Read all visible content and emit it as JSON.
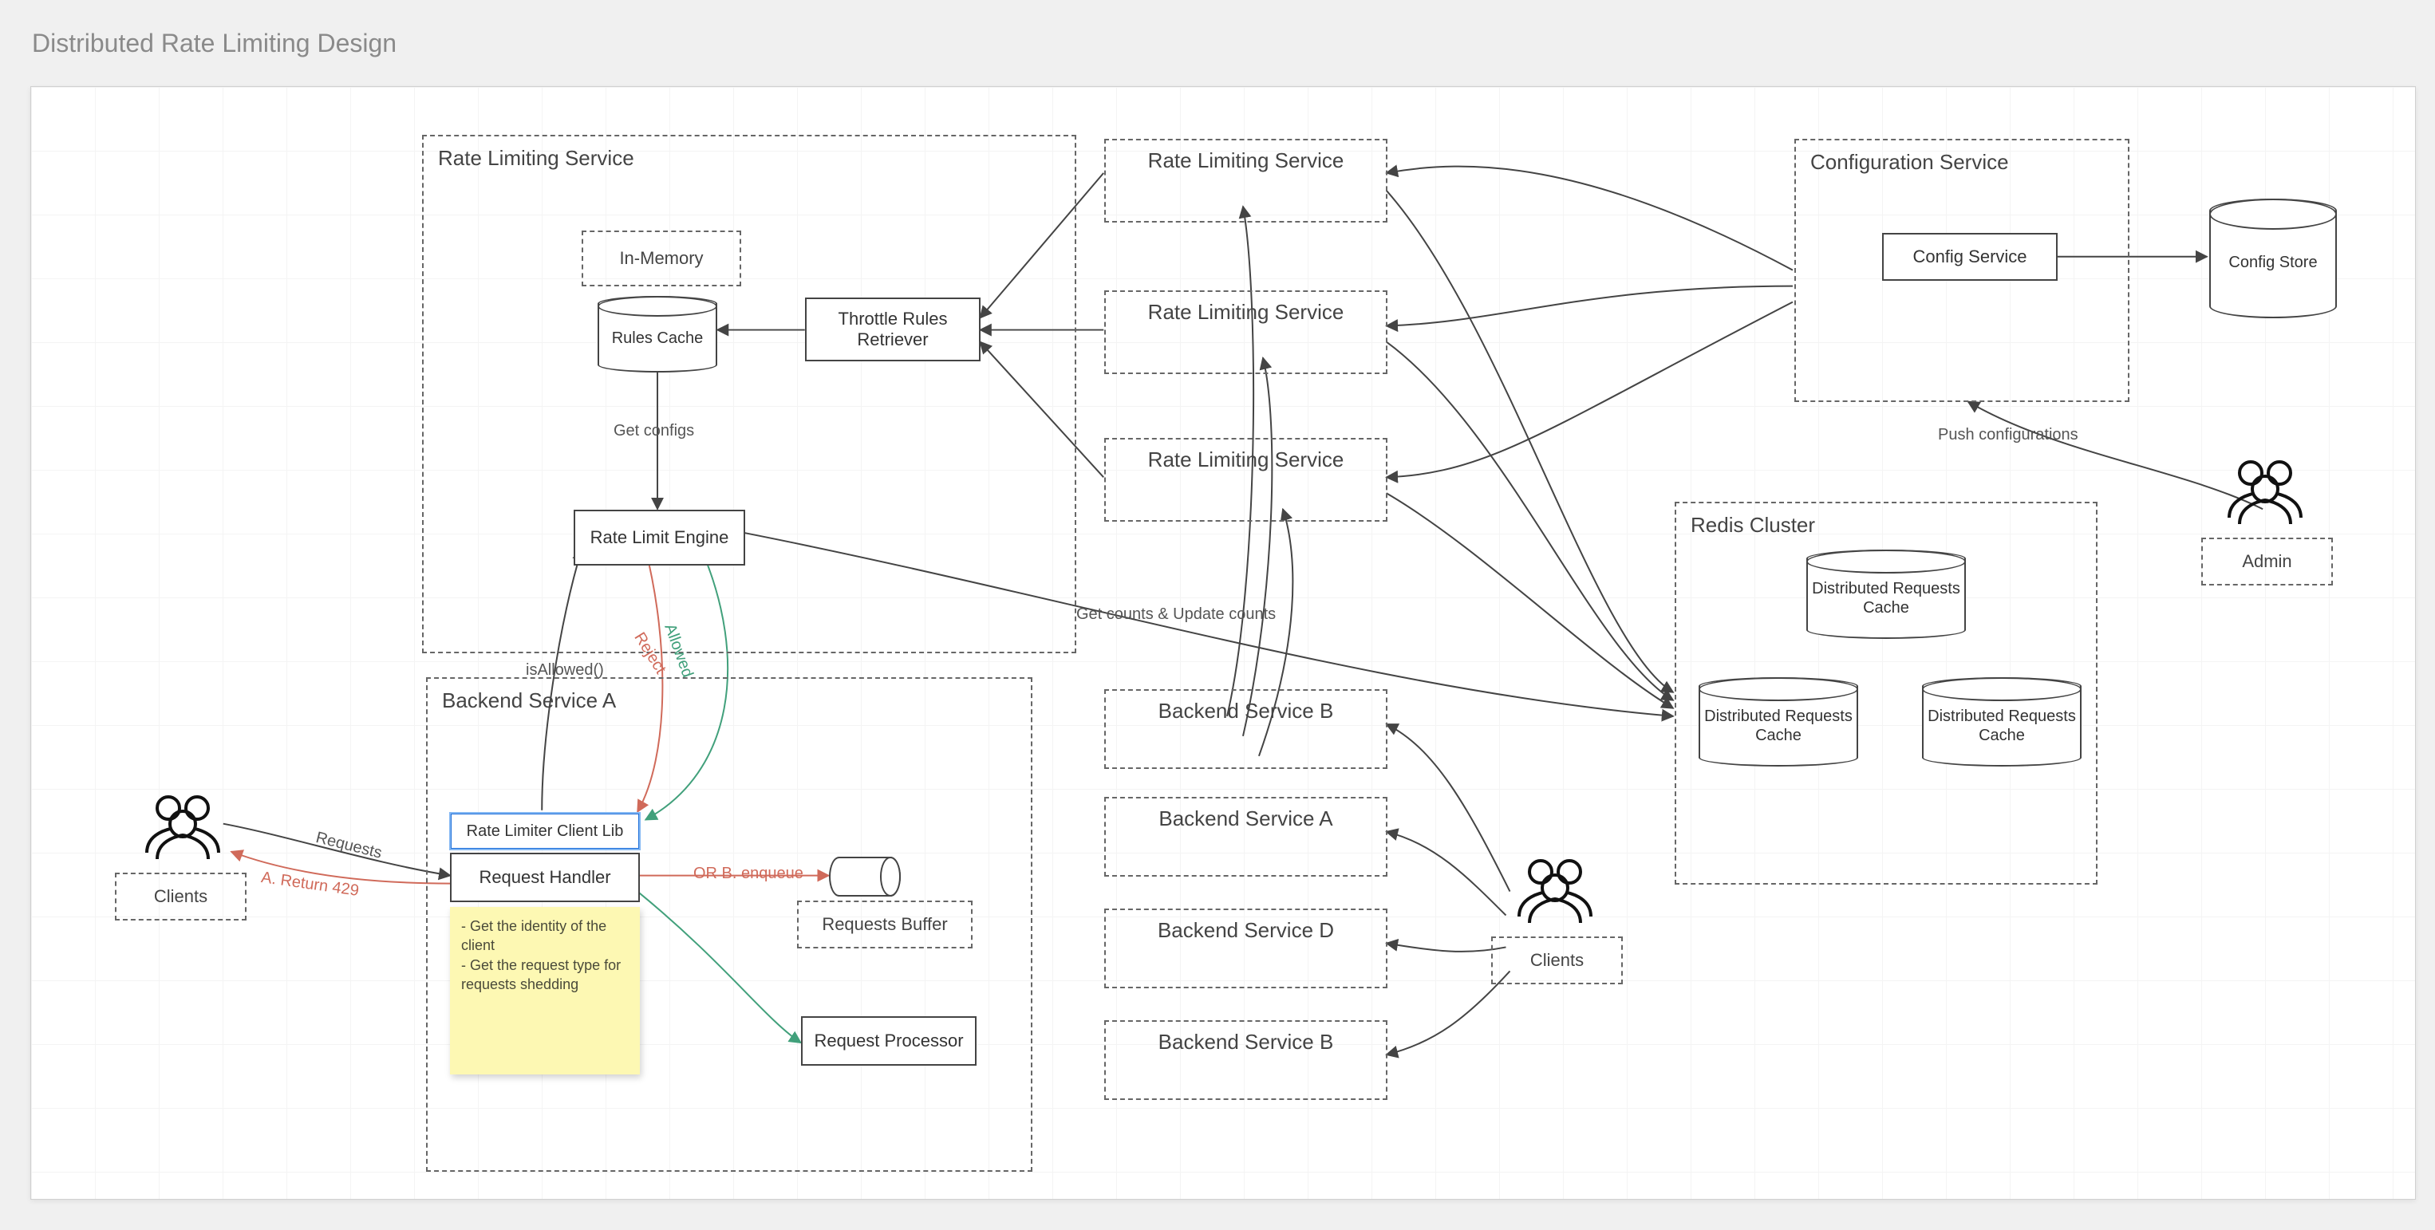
{
  "title": "Distributed Rate Limiting Design",
  "rateLimitSvc": {
    "title": "Rate Limiting Service",
    "inMemory": "In-Memory",
    "rulesCache": "Rules Cache",
    "retriever": "Throttle Rules Retriever",
    "getConfigs": "Get configs",
    "engine": "Rate Limit Engine",
    "isAllowed": "isAllowed()",
    "reject": "Reject",
    "allowed": "Allowed"
  },
  "rateLimitGhosts": {
    "a": "Rate Limiting Service",
    "b": "Rate Limiting Service",
    "c": "Rate Limiting Service"
  },
  "configSvc": {
    "title": "Configuration Service",
    "config": "Config Service",
    "store": "Config Store",
    "push": "Push configurations",
    "admin": "Admin"
  },
  "backend": {
    "title": "Backend Service A",
    "clientLib": "Rate Limiter Client Lib",
    "handler": "Request Handler",
    "buffer": "Requests Buffer",
    "processor": "Request Processor",
    "note": "- Get the identity of the client\n- Get the request type for requests shedding",
    "ret429": "A. Return 429",
    "enqueue": "OR B. enqueue",
    "requests": "Requests"
  },
  "backendGhosts": {
    "b1": "Backend Service B",
    "a1": "Backend Service A",
    "d1": "Backend Service D",
    "b2": "Backend Service B"
  },
  "edges": {
    "counts": "Get counts & Update counts"
  },
  "redis": {
    "title": "Redis Cluster",
    "cache": "Distributed Requests Cache"
  },
  "actors": {
    "clientsLeft": "Clients",
    "clientsRight": "Clients"
  }
}
